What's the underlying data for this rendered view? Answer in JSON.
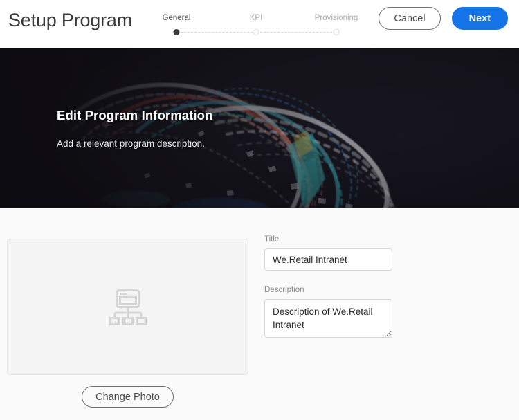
{
  "header": {
    "title": "Setup Program",
    "stepper": {
      "steps": [
        {
          "label": "General",
          "state": "active"
        },
        {
          "label": "KPI",
          "state": "inactive"
        },
        {
          "label": "Provisioning",
          "state": "inactive"
        }
      ]
    },
    "cancel_label": "Cancel",
    "next_label": "Next"
  },
  "hero": {
    "title": "Edit Program Information",
    "subtitle": "Add a relevant program description."
  },
  "photo": {
    "placeholder_icon": "site-hierarchy-icon",
    "change_photo_label": "Change Photo"
  },
  "form": {
    "title_label": "Title",
    "title_value": "We.Retail Intranet",
    "title_placeholder": "Title",
    "description_label": "Description",
    "description_value": "Description of We.Retail Intranet",
    "description_placeholder": "Description"
  },
  "colors": {
    "primary": "#1473e6",
    "page_bg": "#fafafa",
    "panel_bg": "#f4f4f4",
    "hero_bg": "#1c1a22",
    "text_dark": "#3a3a3a",
    "text_muted": "#8d8d8d"
  }
}
